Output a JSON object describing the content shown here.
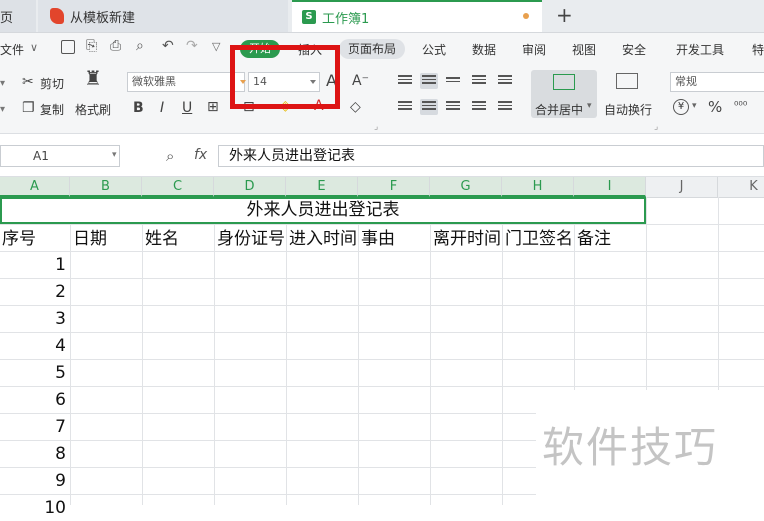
{
  "tabs": {
    "home": "页",
    "template": "从模板新建",
    "workbook": "工作簿1",
    "add": "+"
  },
  "menu": {
    "file": "文件",
    "start": "开始",
    "insert": "插入",
    "page_layout": "页面布局",
    "formula": "公式",
    "data": "数据",
    "review": "审阅",
    "view": "视图",
    "security": "安全",
    "dev_tools": "开发工具",
    "more": "特"
  },
  "ribbon": {
    "cut": "剪切",
    "copy": "复制",
    "format_painter": "格式刷",
    "font_name": "微软雅黑",
    "font_size": "14",
    "bold": "B",
    "italic": "I",
    "underline": "U",
    "merge_center": "合并居中",
    "wrap_text": "自动换行",
    "number_format": "常规",
    "currency": "¥",
    "percent": "%"
  },
  "formula_bar": {
    "cell_ref": "A1",
    "fx": "fx",
    "content": "外来人员进出登记表"
  },
  "columns": [
    "A",
    "B",
    "C",
    "D",
    "E",
    "F",
    "G",
    "H",
    "I",
    "J",
    "K"
  ],
  "sheet": {
    "title": "外来人员进出登记表",
    "headers": [
      "序号",
      "日期",
      "姓名",
      "身份证号",
      "进入时间",
      "事由",
      "离开时间",
      "门卫签名",
      "备注"
    ],
    "row_numbers": [
      "1",
      "2",
      "3",
      "4",
      "5",
      "6",
      "7",
      "8",
      "9",
      "10"
    ]
  },
  "watermark": "软件技巧",
  "colors": {
    "accent_green": "#2b9a4f",
    "highlight_red": "#dd1414"
  }
}
